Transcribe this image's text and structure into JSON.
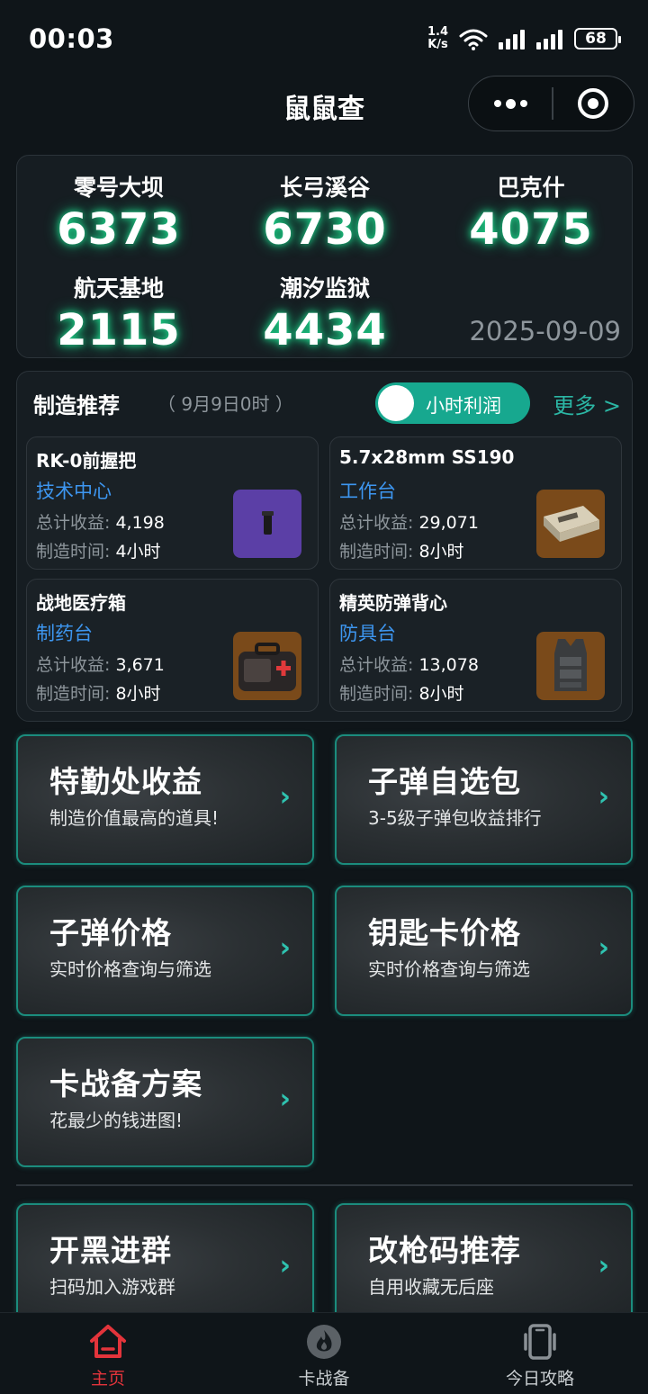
{
  "status_bar": {
    "time": "00:03",
    "net_speed_value": "1.4",
    "net_speed_unit": "K/s",
    "battery": "68"
  },
  "header": {
    "title": "鼠鼠查"
  },
  "maps": [
    {
      "name": "零号大坝",
      "code": "6373"
    },
    {
      "name": "长弓溪谷",
      "code": "6730"
    },
    {
      "name": "巴克什",
      "code": "4075"
    },
    {
      "name": "航天基地",
      "code": "2115"
    },
    {
      "name": "潮汐监狱",
      "code": "4434"
    }
  ],
  "maps_date": "2025-09-09",
  "craft": {
    "title": "制造推荐",
    "subtitle": "（ 9月9日0时 ）",
    "toggle_label": "小时利润",
    "more_label": "更多 >",
    "income_label": "总计收益:",
    "time_label": "制造时间:",
    "items": [
      {
        "name": "RK-0前握把",
        "station": "技术中心",
        "income": "4,198",
        "time": "4小时",
        "thumb_color": "#5b3fa6"
      },
      {
        "name": "5.7x28mm SS190",
        "station": "工作台",
        "income": "29,071",
        "time": "8小时",
        "thumb_color": "#7a4a1a"
      },
      {
        "name": "战地医疗箱",
        "station": "制药台",
        "income": "3,671",
        "time": "8小时",
        "thumb_color": "#7a4a1a"
      },
      {
        "name": "精英防弹背心",
        "station": "防具台",
        "income": "13,078",
        "time": "8小时",
        "thumb_color": "#7a4a1a"
      }
    ]
  },
  "features": [
    {
      "title": "特勤处收益",
      "desc": "制造价值最高的道具!"
    },
    {
      "title": "子弹自选包",
      "desc": "3-5级子弹包收益排行"
    },
    {
      "title": "子弹价格",
      "desc": "实时价格查询与筛选"
    },
    {
      "title": "钥匙卡价格",
      "desc": "实时价格查询与筛选"
    },
    {
      "title": "卡战备方案",
      "desc": "花最少的钱进图!"
    },
    {
      "title": "开黑进群",
      "desc": "扫码加入游戏群"
    },
    {
      "title": "改枪码推荐",
      "desc": "自用收藏无后座"
    }
  ],
  "feature_arrow": "›",
  "nav": [
    {
      "label": "主页",
      "icon": "home-icon"
    },
    {
      "label": "卡战备",
      "icon": "flame-icon"
    },
    {
      "label": "今日攻略",
      "icon": "phone-icon"
    }
  ],
  "colors": {
    "accent": "#17a88f",
    "glow": "#1fd38a",
    "link": "#3d96f0",
    "nav_active": "#e3343b"
  }
}
